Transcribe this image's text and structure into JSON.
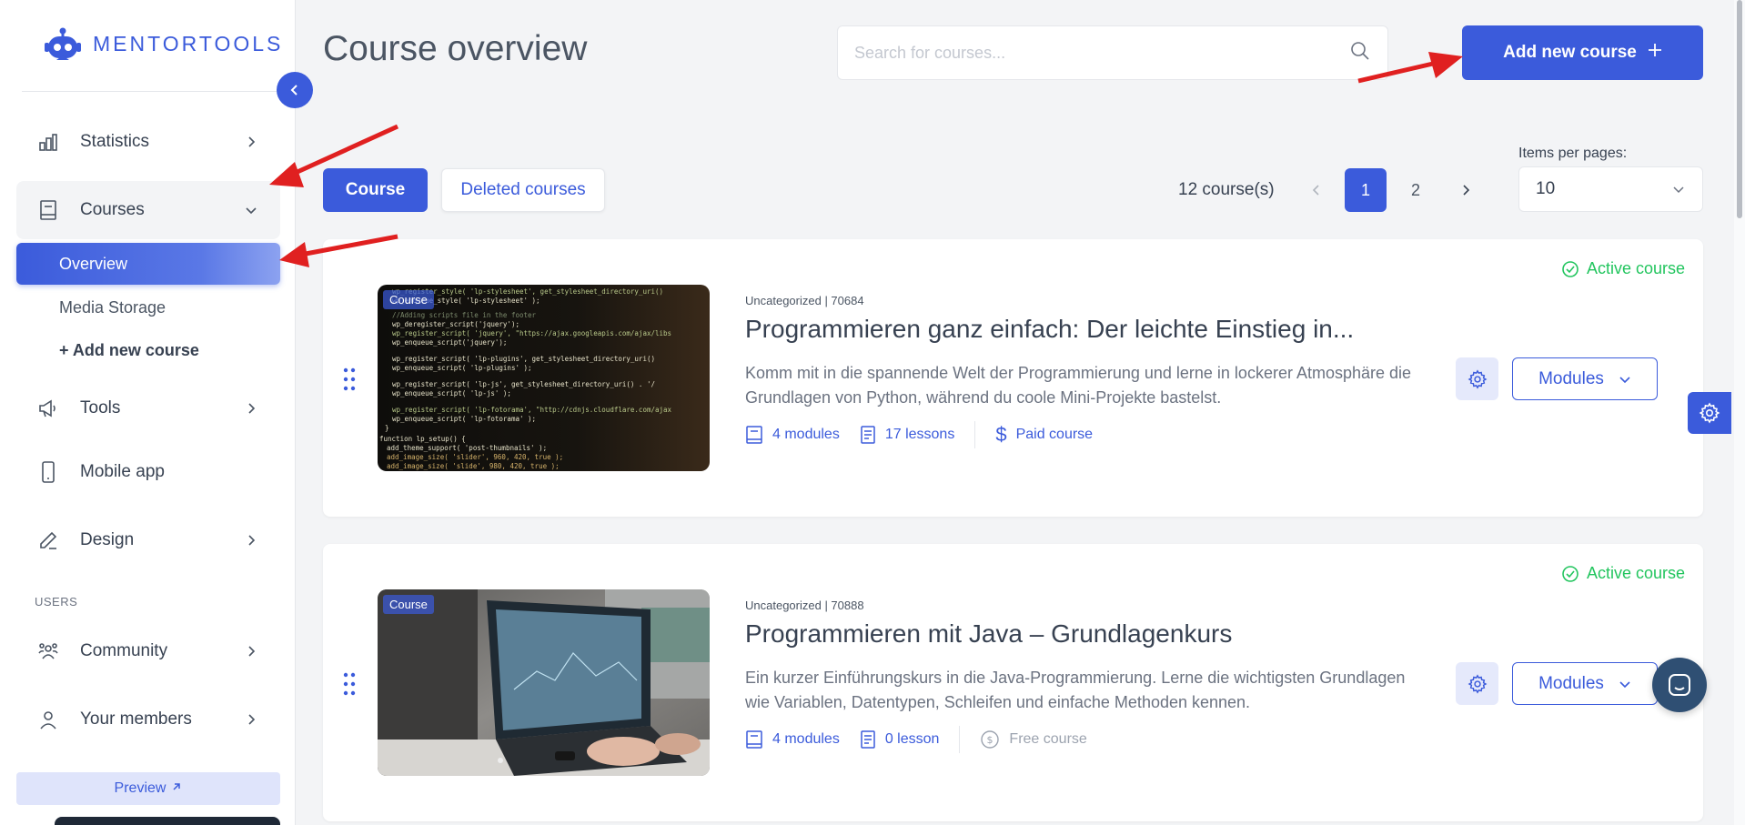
{
  "brand": {
    "name": "MENTORTOOLS",
    "accent": "#3b5bdb"
  },
  "sidebar": {
    "items": [
      {
        "label": "Statistics",
        "icon": "bar-chart-icon"
      },
      {
        "label": "Courses",
        "icon": "book-icon"
      },
      {
        "label": "Tools",
        "icon": "megaphone-icon"
      },
      {
        "label": "Mobile app",
        "icon": "phone-icon"
      },
      {
        "label": "Design",
        "icon": "pencil-icon"
      },
      {
        "label": "Community",
        "icon": "people-icon"
      },
      {
        "label": "Your members",
        "icon": "user-icon"
      }
    ],
    "sub_items": [
      {
        "label": "Overview"
      },
      {
        "label": "Media Storage"
      },
      {
        "label": "+ Add new course"
      }
    ],
    "section_users": "USERS",
    "preview_label": "Preview"
  },
  "header": {
    "title": "Course overview",
    "search_placeholder": "Search for courses...",
    "add_button": "Add new course"
  },
  "tabs": [
    {
      "label": "Course"
    },
    {
      "label": "Deleted courses"
    }
  ],
  "pagination": {
    "count_label": "12 course(s)",
    "pages": [
      "1",
      "2"
    ],
    "current": "1",
    "items_per_page_label": "Items per pages:",
    "items_per_page_value": "10"
  },
  "courses": [
    {
      "badge": "Course",
      "meta": "Uncategorized | 70684",
      "title": "Programmieren ganz einfach: Der leichte Einstieg in...",
      "description": "Komm mit in die spannende Welt der Programmierung und lerne in lockerer Atmosphäre die Grundlagen von Python, während du coole Mini-Projekte bastelst.",
      "modules": "4 modules",
      "lessons": "17 lessons",
      "price": "Paid course",
      "status": "Active course",
      "modules_button": "Modules"
    },
    {
      "badge": "Course",
      "meta": "Uncategorized | 70888",
      "title": "Programmieren mit Java – Grundlagenkurs",
      "description": "Ein kurzer Einführungskurs in die Java-Programmierung. Lerne die wichtigsten Grundlagen wie Variablen, Datentypen, Schleifen und einfache Methoden kennen.",
      "modules": "4 modules",
      "lessons": "0 lesson",
      "price": "Free course",
      "status": "Active course",
      "modules_button": "Modules"
    }
  ],
  "colors": {
    "accent": "#3b5bdb",
    "success": "#22c55e",
    "annotation": "#e02020"
  }
}
